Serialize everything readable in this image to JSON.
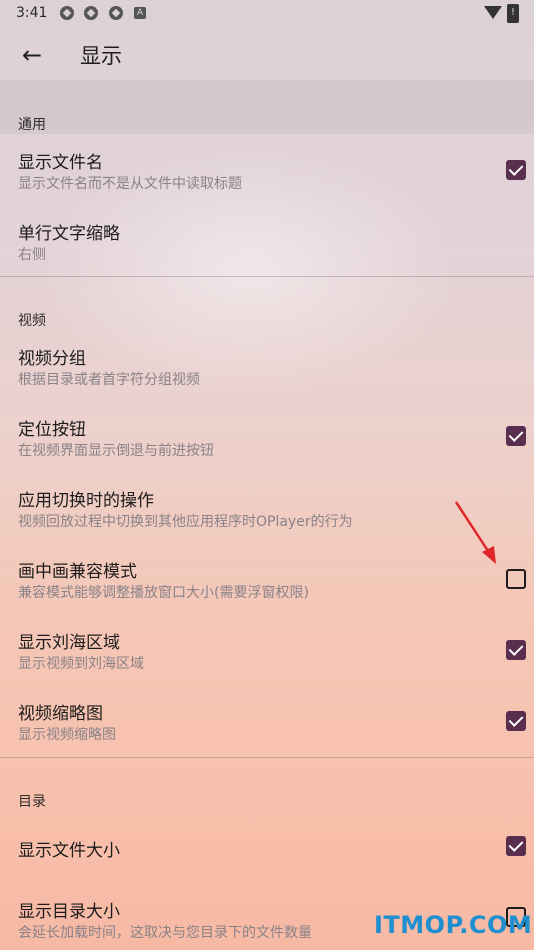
{
  "status": {
    "time": "3:41",
    "notif_icons": [
      "app-icon",
      "app-icon",
      "app-icon"
    ],
    "battery": "!"
  },
  "appbar": {
    "title": "显示"
  },
  "sections": [
    {
      "header": "通用"
    },
    {
      "header": "视频"
    },
    {
      "header": "目录"
    }
  ],
  "items": [
    {
      "title": "显示文件名",
      "subtitle": "显示文件名而不是从文件中读取标题",
      "checked": true
    },
    {
      "title": "单行文字缩略",
      "subtitle": "右侧",
      "checked": null
    },
    {
      "title": "视频分组",
      "subtitle": "根据目录或者首字符分组视频",
      "checked": null
    },
    {
      "title": "定位按钮",
      "subtitle": "在视频界面显示倒退与前进按钮",
      "checked": true
    },
    {
      "title": "应用切换时的操作",
      "subtitle": "视频回放过程中切换到其他应用程序时OPlayer的行为",
      "checked": null
    },
    {
      "title": "画中画兼容模式",
      "subtitle": "兼容模式能够调整播放窗口大小(需要浮窗权限)",
      "checked": false
    },
    {
      "title": "显示刘海区域",
      "subtitle": "显示视频到刘海区域",
      "checked": true
    },
    {
      "title": "视频缩略图",
      "subtitle": "显示视频缩略图",
      "checked": true
    },
    {
      "title": "显示文件大小",
      "subtitle": "",
      "checked": true
    },
    {
      "title": "显示目录大小",
      "subtitle": "会延长加载时间，这取决与您目录下的文件数量",
      "checked": false
    }
  ],
  "watermark": "ITMOP.COM",
  "colors": {
    "accent": "#5a2e4f",
    "annotation_arrow": "#e0262a",
    "watermark": "#1f8fd0"
  }
}
